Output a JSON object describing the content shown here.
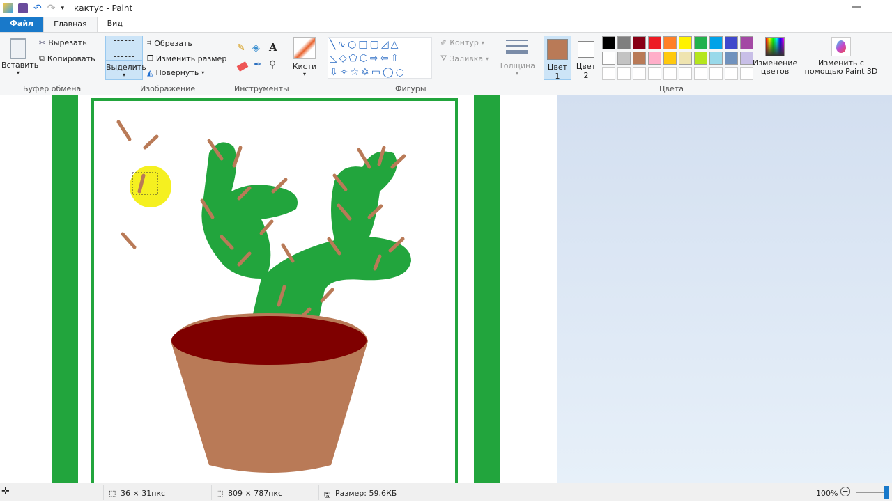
{
  "window": {
    "title": "кактус - Paint"
  },
  "tabs": {
    "file": "Файл",
    "home": "Главная",
    "view": "Вид"
  },
  "clipboard": {
    "paste": "Вставить",
    "cut": "Вырезать",
    "copy": "Копировать",
    "label": "Буфер обмена"
  },
  "image": {
    "select": "Выделить",
    "crop": "Обрезать",
    "resize": "Изменить размер",
    "rotate": "Повернуть",
    "label": "Изображение"
  },
  "tools": {
    "label": "Инструменты",
    "brushes": "Кисти"
  },
  "shapes": {
    "label": "Фигуры",
    "outline": "Контур",
    "fill": "Заливка"
  },
  "size": {
    "label": "Толщина"
  },
  "colors": {
    "color1": "Цвет",
    "color1_n": "1",
    "color2": "Цвет",
    "color2_n": "2",
    "edit": "Изменение цветов",
    "paint3d": "Изменить с помощью Paint 3D",
    "label": "Цвета",
    "color1_value": "#b97a57",
    "color2_value": "#ffffff",
    "palette_row1": [
      "#000000",
      "#7f7f7f",
      "#880015",
      "#ed1c24",
      "#ff7f27",
      "#fff200",
      "#22b14c",
      "#00a2e8",
      "#3f48cc",
      "#a349a4"
    ],
    "palette_row2": [
      "#ffffff",
      "#c3c3c3",
      "#b97a57",
      "#ffaec9",
      "#ffc90e",
      "#efe4b0",
      "#b5e61d",
      "#99d9ea",
      "#7092be",
      "#c8bfe7"
    ]
  },
  "status": {
    "selection": "36 × 31пкс",
    "image_size": "809 × 787пкс",
    "file_size": "Размер: 59,6КБ",
    "zoom": "100%"
  }
}
